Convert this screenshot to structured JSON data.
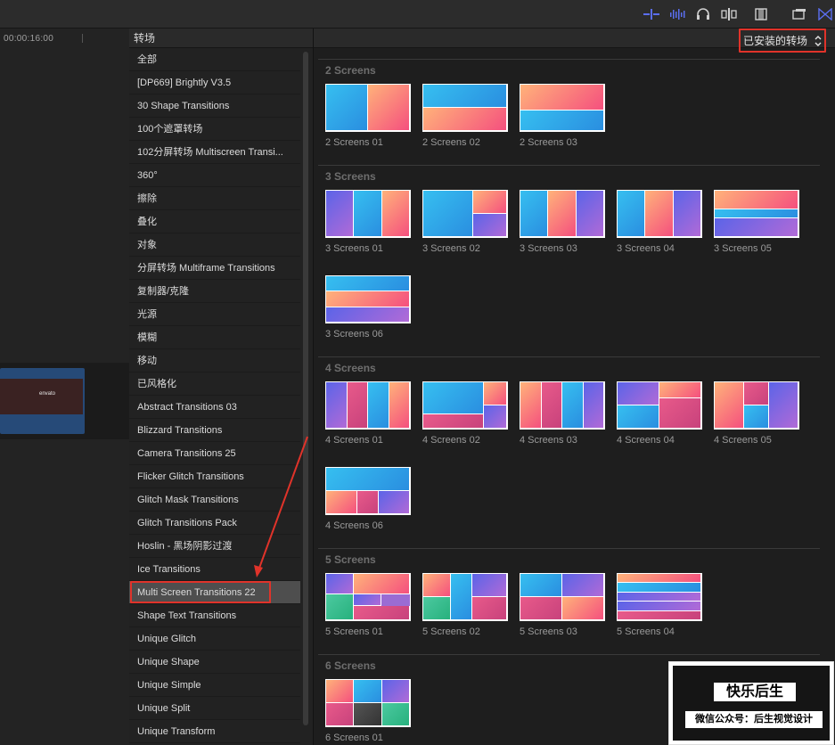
{
  "topbar": {
    "icons": [
      "audio-skimming-icon",
      "audio-waveform-icon",
      "headphones-icon",
      "clip-skimming-icon",
      "film-icon",
      "window-icon",
      "bowtie-icon"
    ]
  },
  "timeline": {
    "timecode": "00:00:16:00",
    "clip_label": "envato"
  },
  "categories": {
    "header": "转场",
    "items": [
      "全部",
      "[DP669] Brightly V3.5",
      "30 Shape Transitions",
      "100个遮罩转场",
      "102分屏转场 Multiscreen Transi...",
      "360°",
      "擦除",
      "叠化",
      "对象",
      "分屏转场 Multiframe Transitions",
      "复制器/克隆",
      "光源",
      "模糊",
      "移动",
      "已风格化",
      "Abstract Transitions 03",
      "Blizzard Transitions",
      "Camera Transitions 25",
      "Flicker Glitch Transitions",
      "Glitch Mask Transitions",
      "Glitch Transitions Pack",
      "Hoslin - 黑场阴影过渡",
      "Ice Transitions",
      "Multi Screen Transitions 22",
      "Shape Text Transitions",
      "Unique Glitch",
      "Unique Shape",
      "Unique Simple",
      "Unique Split",
      "Unique Transform"
    ],
    "selected_index": 23
  },
  "browser": {
    "filter_label": "已安装的转场",
    "sections": [
      {
        "title": "2 Screens",
        "items": [
          "2 Screens 01",
          "2 Screens 02",
          "2 Screens 03"
        ]
      },
      {
        "title": "3 Screens",
        "items": [
          "3 Screens 01",
          "3 Screens 02",
          "3 Screens 03",
          "3 Screens 04",
          "3 Screens 05",
          "3 Screens 06"
        ]
      },
      {
        "title": "4 Screens",
        "items": [
          "4 Screens 01",
          "4 Screens 02",
          "4 Screens 03",
          "4 Screens 04",
          "4 Screens 05",
          "4 Screens 06"
        ]
      },
      {
        "title": "5 Screens",
        "items": [
          "5 Screens 01",
          "5 Screens 02",
          "5 Screens 03",
          "5 Screens 04"
        ]
      },
      {
        "title": "6 Screens",
        "items": [
          "6 Screens 01"
        ]
      }
    ]
  },
  "annotation": {
    "accent_color": "#e0332a"
  },
  "watermark": {
    "title": "快乐后生",
    "subtitle": "微信公众号：后生视觉设计"
  }
}
